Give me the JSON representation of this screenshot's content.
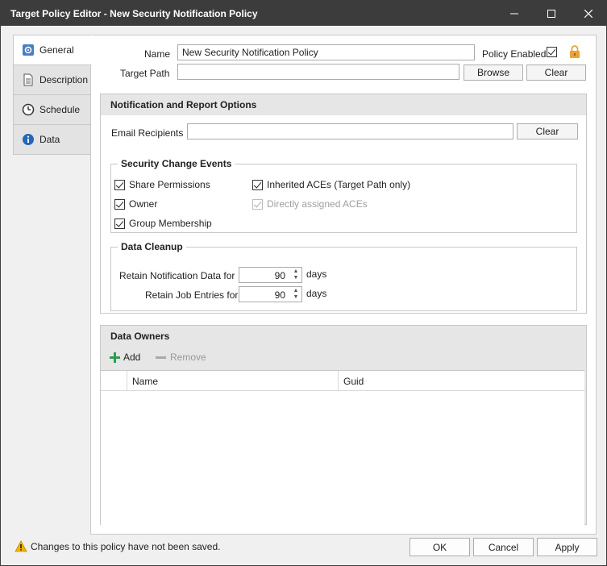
{
  "window": {
    "title": "Target Policy Editor - New Security Notification Policy"
  },
  "tabs": [
    {
      "label": "General",
      "icon": "general-icon"
    },
    {
      "label": "Description",
      "icon": "document-icon"
    },
    {
      "label": "Schedule",
      "icon": "clock-icon"
    },
    {
      "label": "Data",
      "icon": "info-icon"
    }
  ],
  "general": {
    "name_label": "Name",
    "name_value": "New Security Notification Policy",
    "policy_enabled_label": "Policy Enabled",
    "target_path_label": "Target Path",
    "target_path_value": "",
    "browse_label": "Browse",
    "clear_label": "Clear"
  },
  "notification": {
    "header": "Notification and Report Options",
    "email_label": "Email Recipients",
    "email_value": "",
    "clear_label": "Clear",
    "events_title": "Security Change Events",
    "events": {
      "share_permissions": "Share Permissions",
      "owner": "Owner",
      "group_membership": "Group Membership",
      "inherited_aces": "Inherited ACEs  (Target Path only)",
      "directly_assigned": "Directly assigned ACEs"
    },
    "cleanup_title": "Data Cleanup",
    "retain_notification_label": "Retain Notification Data for",
    "retain_notification_value": "90",
    "retain_jobs_label": "Retain Job Entries for",
    "retain_jobs_value": "90",
    "days_label": "days"
  },
  "owners": {
    "header": "Data Owners",
    "add_label": "Add",
    "remove_label": "Remove",
    "columns": [
      "Name",
      "Guid"
    ]
  },
  "footer": {
    "warning": "Changes to this policy have not been saved.",
    "ok": "OK",
    "cancel": "Cancel",
    "apply": "Apply"
  },
  "colors": {
    "titlebar": "#3c3c3c",
    "accent_add": "#2e9e4f",
    "lock": "#e8a33a",
    "warning": "#f0b400"
  }
}
